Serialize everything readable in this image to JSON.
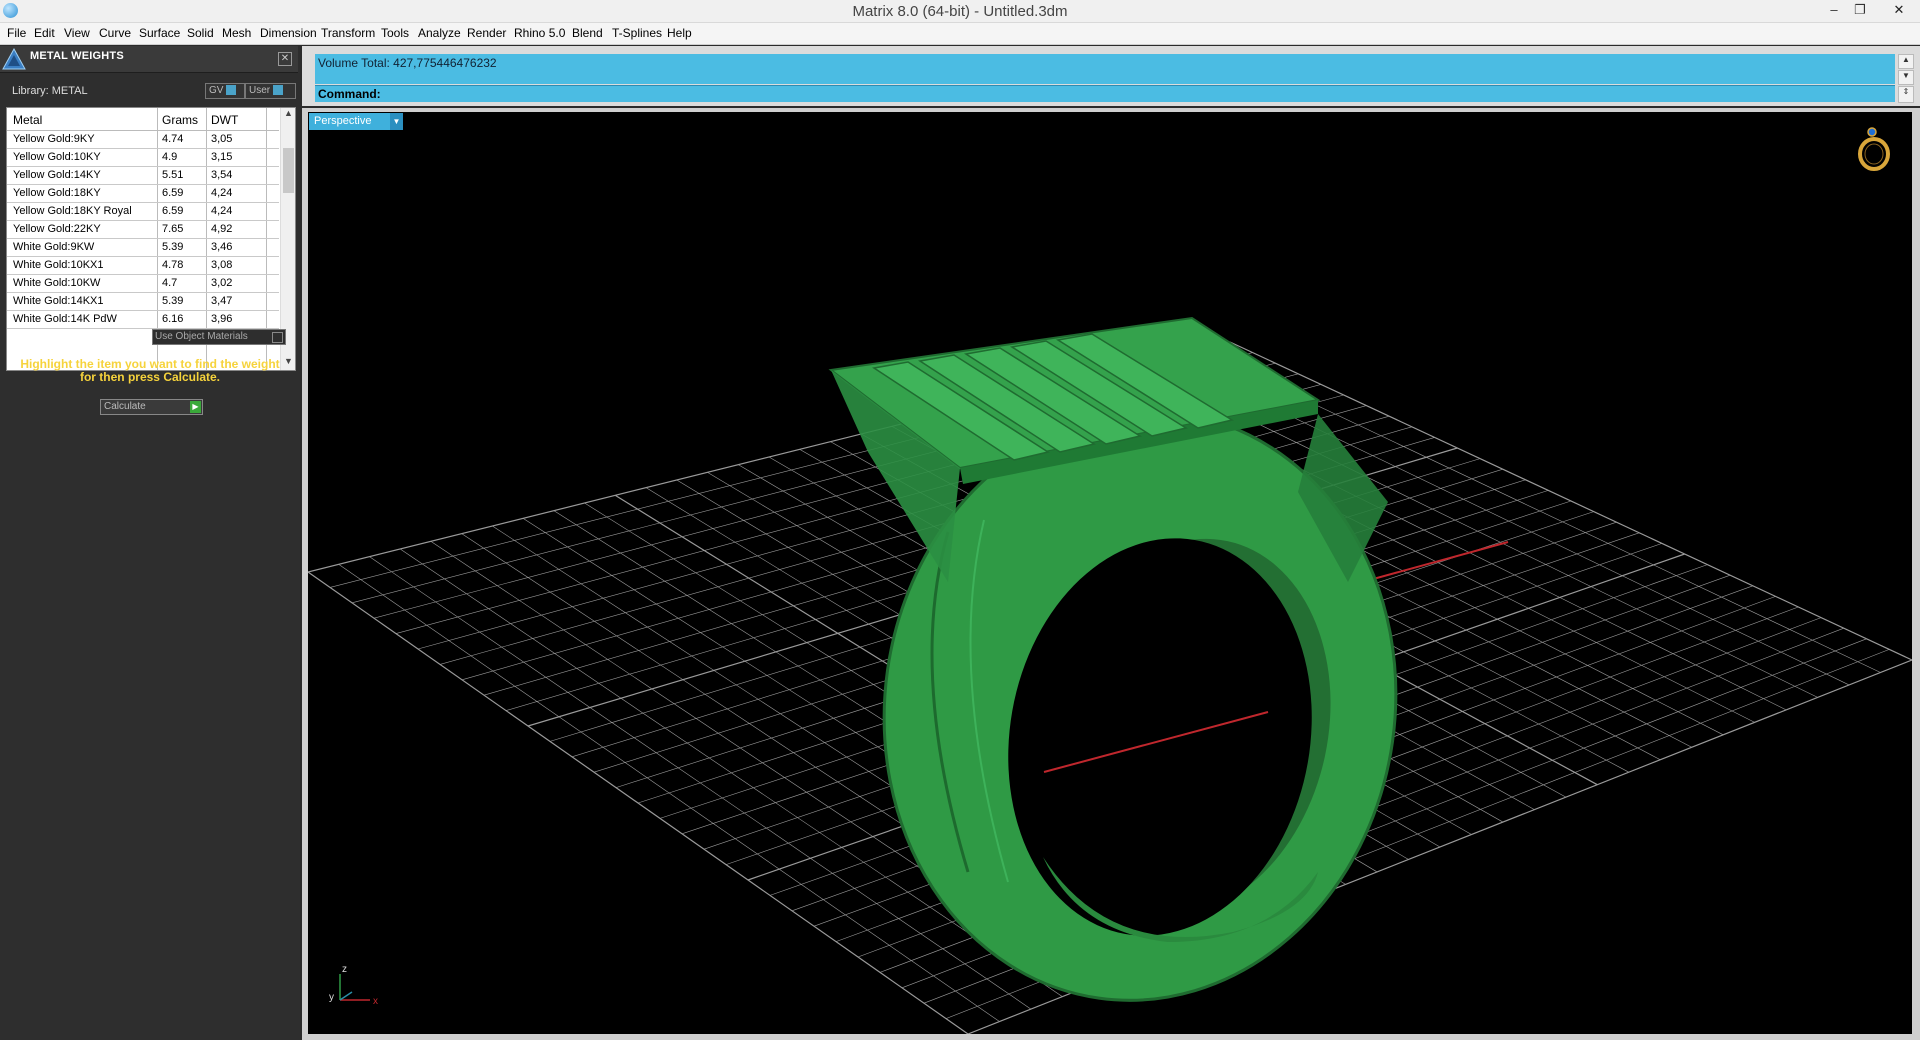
{
  "window": {
    "title": "Matrix 8.0 (64-bit) - Untitled.3dm",
    "controls": [
      "–",
      "❐",
      "✕"
    ]
  },
  "menu": [
    "File",
    "Edit",
    "View",
    "Curve",
    "Surface",
    "Solid",
    "Mesh",
    "Dimension",
    "Transform",
    "Tools",
    "Analyze",
    "Render",
    "Rhino 5.0",
    "Blend",
    "T-Splines",
    "Help"
  ],
  "panel": {
    "title": "METAL WEIGHTS",
    "library_label": "Library: METAL",
    "toggle_gv": "GV",
    "toggle_user": "User",
    "columns": [
      "Metal",
      "Grams",
      "DWT"
    ],
    "rows": [
      [
        "Yellow Gold:9KY",
        "4.74",
        "3,05"
      ],
      [
        "Yellow Gold:10KY",
        "4.9",
        "3,15"
      ],
      [
        "Yellow Gold:14KY",
        "5.51",
        "3,54"
      ],
      [
        "Yellow Gold:18KY",
        "6.59",
        "4,24"
      ],
      [
        "Yellow Gold:18KY Royal",
        "6.59",
        "4,24"
      ],
      [
        "Yellow Gold:22KY",
        "7.65",
        "4,92"
      ],
      [
        "White Gold:9KW",
        "5.39",
        "3,46"
      ],
      [
        "White Gold:10KX1",
        "4.78",
        "3,08"
      ],
      [
        "White Gold:10KW",
        "4.7",
        "3,02"
      ],
      [
        "White Gold:14KX1",
        "5.39",
        "3,47"
      ],
      [
        "White Gold:14K PdW",
        "6.16",
        "3,96"
      ]
    ],
    "use_object_materials": "Use Object Materials",
    "instruction": "Highlight the item you want to find the weight for then press Calculate.",
    "calculate_label": "Calculate"
  },
  "command_area": {
    "history_text": "Volume Total: 427,775446476232",
    "command_label": "Command:"
  },
  "viewport": {
    "name": "Perspective",
    "axis_labels": {
      "z": "z",
      "y": "y",
      "x": "x"
    },
    "colors": {
      "model": "#2f9a45",
      "grid": "#9a9a9a",
      "x_axis": "#c0272d",
      "y_axis": "#2a8fa8",
      "tab": "#3fb0dc"
    }
  }
}
